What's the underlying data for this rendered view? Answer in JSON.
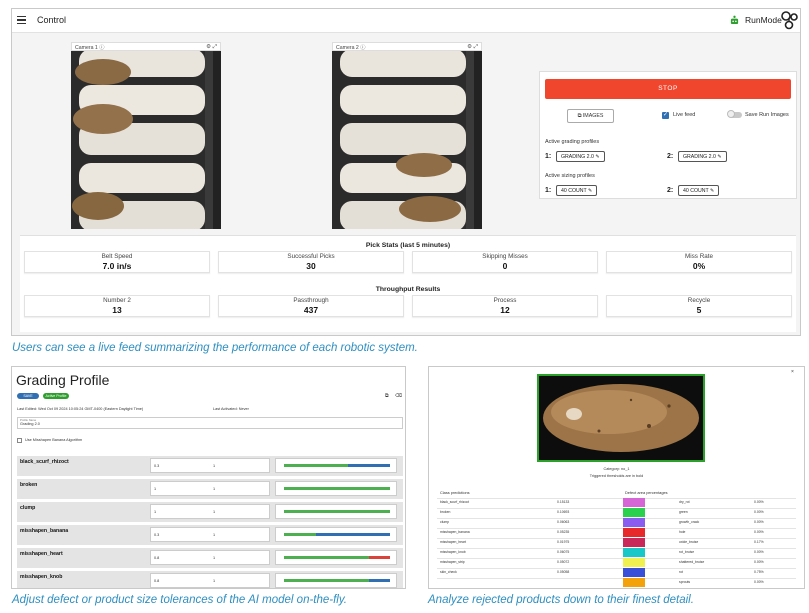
{
  "top": {
    "app_title": "Control",
    "run_mode_label": "RunMode",
    "cameras": [
      {
        "label": "Camera 1"
      },
      {
        "label": "Camera 2"
      }
    ],
    "controls": {
      "stop_label": "STOP",
      "images_label": "IMAGES",
      "live_feed_label": "Live feed",
      "live_feed_checked": true,
      "save_run_images_label": "Save Run Images",
      "grading_heading": "Active grading profiles",
      "sizing_heading": "Active sizing profiles",
      "grading": [
        {
          "slot": "1:",
          "value": "GRADING 2.0"
        },
        {
          "slot": "2:",
          "value": "GRADING 2.0"
        }
      ],
      "sizing": [
        {
          "slot": "1:",
          "value": "40 COUNT"
        },
        {
          "slot": "2:",
          "value": "40 COUNT"
        }
      ],
      "stop_color": "#f0462e",
      "accent_color": "#2f6fb2"
    },
    "pick_stats": {
      "title": "Pick Stats (last 5 minutes)",
      "items": [
        {
          "label": "Belt Speed",
          "value": "7.0 in/s"
        },
        {
          "label": "Successful Picks",
          "value": "30"
        },
        {
          "label": "Skipping Misses",
          "value": "0"
        },
        {
          "label": "Miss Rate",
          "value": "0%"
        }
      ]
    },
    "throughput": {
      "title": "Throughput Results",
      "items": [
        {
          "label": "Number 2",
          "value": "13"
        },
        {
          "label": "Passthrough",
          "value": "437"
        },
        {
          "label": "Process",
          "value": "12"
        },
        {
          "label": "Recycle",
          "value": "5"
        }
      ]
    }
  },
  "captions": {
    "top": "Users can see a live feed summarizing the performance of each robotic system.",
    "bottom_left": "Adjust defect or product size tolerances of the AI model on-the-fly.",
    "bottom_right": "Analyze rejected products down to their finest detail."
  },
  "grading_profile": {
    "title": "Grading Profile",
    "save_label": "SAVE",
    "activate_label": "Active Profile",
    "last_edited": "Last Edited: Wed Oct 09 2024 10:05:24 GMT-0400 (Eastern Daylight Time)",
    "last_activated": "Last Activated: Never",
    "profile_name_label": "Profile Name",
    "profile_name_value": "Grading 2.0",
    "checkbox_label": "Use Misshapen Banana Algorithm",
    "defects": [
      {
        "name": "black_scurf_rhizoct",
        "min": "0.3",
        "max": "1",
        "green_frac": 0.6,
        "blue_frac": 0.4,
        "red_frac": 0
      },
      {
        "name": "broken",
        "min": "1",
        "max": "1",
        "green_frac": 1.0,
        "blue_frac": 0,
        "red_frac": 0
      },
      {
        "name": "clump",
        "min": "1",
        "max": "1",
        "green_frac": 1.0,
        "blue_frac": 0,
        "red_frac": 0
      },
      {
        "name": "misshapen_banana",
        "min": "0.3",
        "max": "1",
        "green_frac": 0.3,
        "blue_frac": 0.7,
        "red_frac": 0
      },
      {
        "name": "misshapen_heart",
        "min": "0.8",
        "max": "1",
        "green_frac": 0.8,
        "blue_frac": 0,
        "red_frac": 0.2
      },
      {
        "name": "misshapen_knob",
        "min": "0.8",
        "max": "1",
        "green_frac": 0.8,
        "blue_frac": 0.2,
        "red_frac": 0
      }
    ]
  },
  "analysis": {
    "category_line": "Category: no_1",
    "triggered_line": "Triggered thresholds are in bold",
    "class_head": "Class predictions",
    "area_head": "Defect area percentages",
    "rows": [
      {
        "cls": "black_scurf_rhizoct",
        "score": "0.15133",
        "color": "#d666d6",
        "area_name": "dry_rot",
        "area": "0.00%"
      },
      {
        "cls": "broken",
        "score": "0.10693",
        "color": "#29d14f",
        "area_name": "green",
        "area": "0.00%"
      },
      {
        "cls": "clump",
        "score": "0.06063",
        "color": "#8a5cf0",
        "area_name": "growth_crack",
        "area": "0.00%"
      },
      {
        "cls": "misshapen_banana",
        "score": "0.05235",
        "color": "#e8292c",
        "area_name": "hole",
        "area": "0.00%"
      },
      {
        "cls": "misshapen_heart",
        "score": "0.01975",
        "color": "#c8285a",
        "area_name": "oxide_bruise",
        "area": "0.17%"
      },
      {
        "cls": "misshapen_knob",
        "score": "0.06075",
        "color": "#18c7c7",
        "area_name": "rot_bruise",
        "area": "0.00%"
      },
      {
        "cls": "misshapen_strip",
        "score": "0.05072",
        "color": "#f0f050",
        "area_name": "shattered_bruise",
        "area": "0.00%"
      },
      {
        "cls": "skin_check",
        "score": "0.05058",
        "color": "#3a4fd8",
        "area_name": "rot",
        "area": "0.75%"
      },
      {
        "cls": "",
        "score": "",
        "color": "#f3a20c",
        "area_name": "sprouts",
        "area": "0.00%"
      }
    ]
  }
}
